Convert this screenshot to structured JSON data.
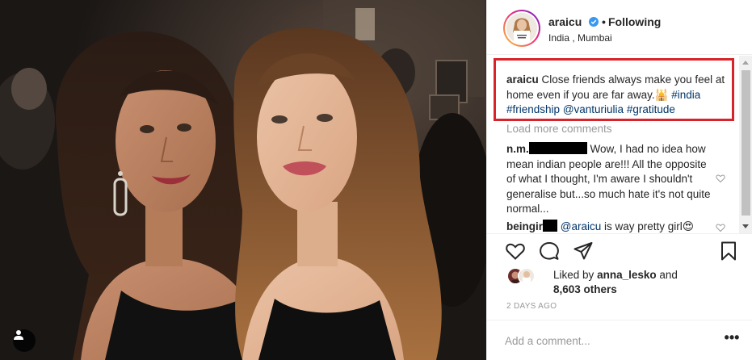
{
  "post": {
    "photo_alt": "",
    "tag_icon": "user-silhouette-icon"
  },
  "header": {
    "username": "araicu",
    "verified_icon": "verified-badge-icon",
    "separator": "•",
    "follow_status": "Following",
    "location": "India , Mumbai"
  },
  "caption": {
    "author": "araicu",
    "text": "Close friends always make you feel at home even if you are far away.",
    "emoji": "🕌",
    "hashtag1": "#india",
    "hashtag2": "#friendship",
    "mention": "@vanturiulia",
    "hashtag3": "#gratitude",
    "highlight_color": "#d9232b"
  },
  "load_more": "Load more comments",
  "comments": [
    {
      "author": "n.m.",
      "text_line": "Wow, I had no idea how mean indian people are!!! All the opposite of what I thought, I'm aware I shouldn't generalise but...so much hate it's not quite normal..."
    },
    {
      "author": "beingir",
      "mention": "@araicu",
      "text": "is way pretty girl",
      "emoji": "😍"
    }
  ],
  "actions": {
    "like_icon": "heart-icon",
    "comment_icon": "speech-bubble-icon",
    "share_icon": "paper-plane-icon",
    "save_icon": "bookmark-icon"
  },
  "likes": {
    "prefix": "Liked by",
    "user": "anna_lesko",
    "joiner": "and",
    "others": "8,603 others"
  },
  "timestamp": "2 DAYS AGO",
  "add_comment": {
    "placeholder": "Add a comment...",
    "more_label": "•••"
  }
}
